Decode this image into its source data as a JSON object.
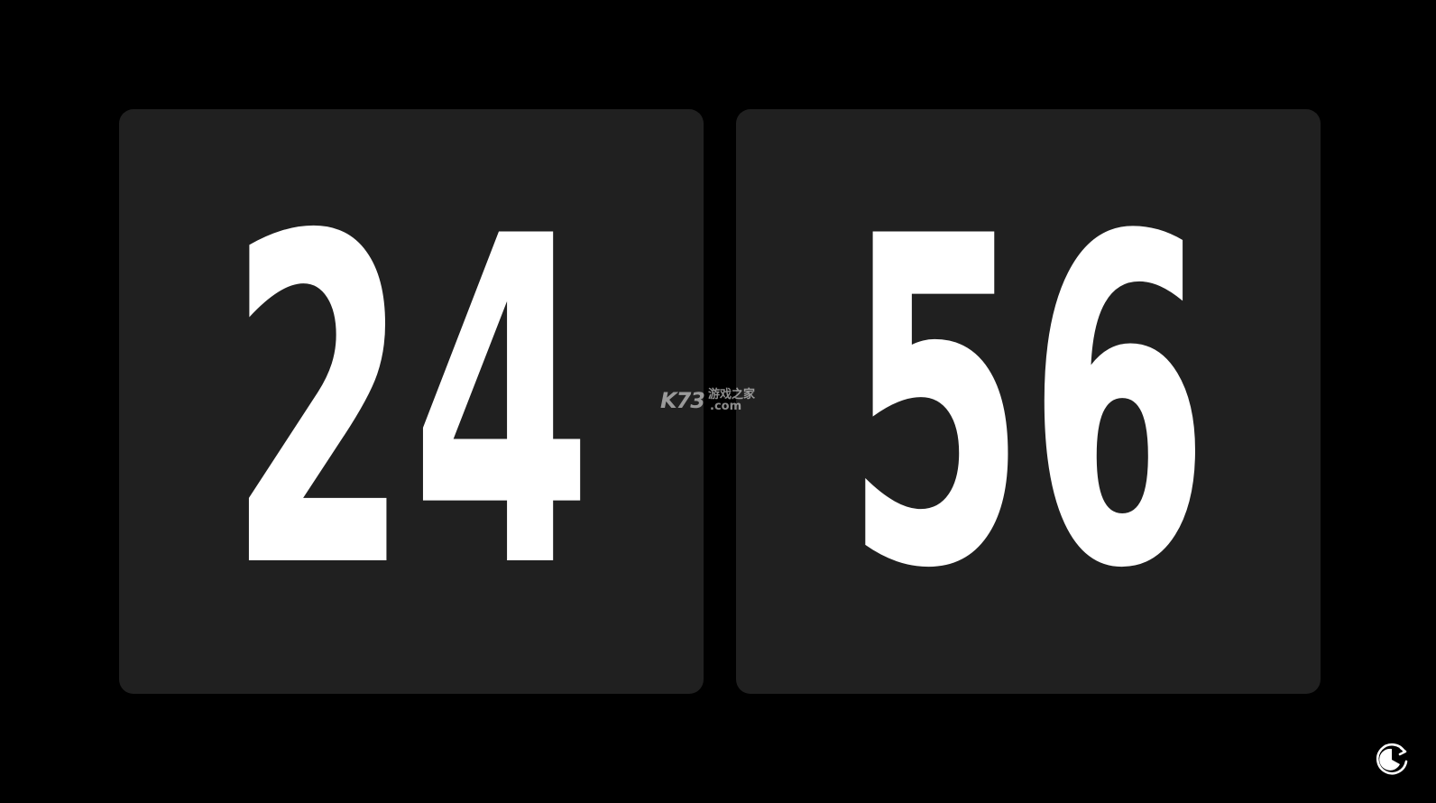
{
  "clock": {
    "hours": "24",
    "minutes": "56"
  },
  "watermark": {
    "logo": "K73",
    "name": "游戏之家",
    "domain": ".com"
  },
  "controls": {
    "mode_icon": "timer-mode-icon"
  },
  "colors": {
    "background": "#000000",
    "card": "#202020",
    "digits": "#ffffff"
  }
}
